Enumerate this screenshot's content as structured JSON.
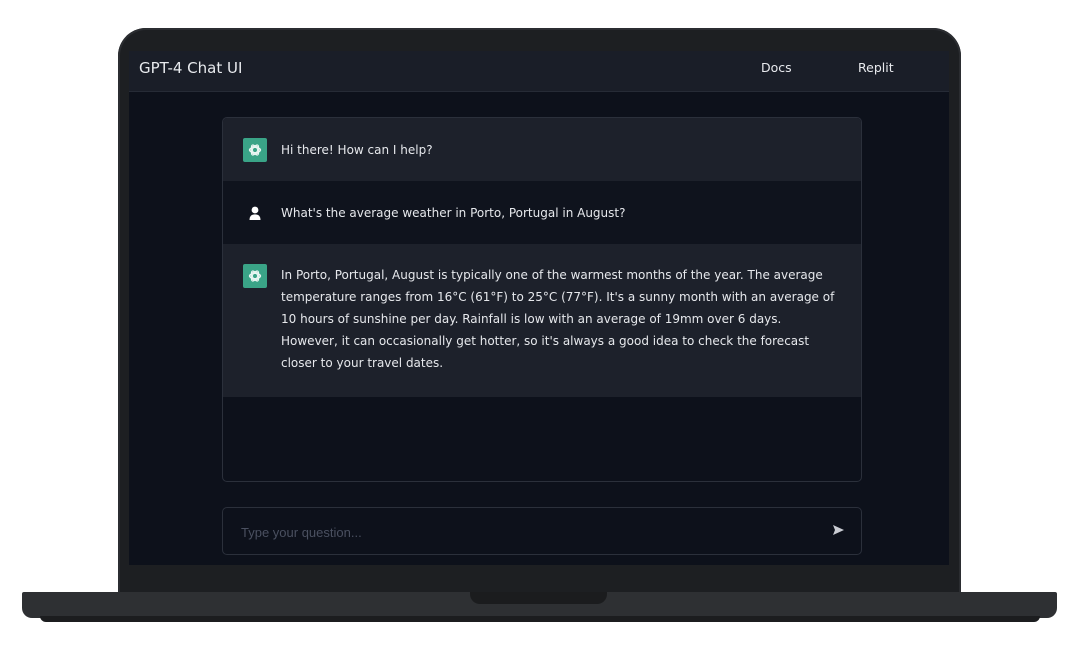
{
  "app": {
    "title": "GPT-4 Chat UI",
    "nav_links": [
      "Docs",
      "Replit"
    ]
  },
  "messages": [
    {
      "role": "assistant",
      "avatar_icon": "openai-logo-icon",
      "text": "Hi there! How can I help?"
    },
    {
      "role": "user",
      "avatar_icon": "user-icon",
      "text": "What's the average weather in Porto, Portugal in August?"
    },
    {
      "role": "assistant",
      "avatar_icon": "openai-logo-icon",
      "text": "In Porto, Portugal, August is typically one of the warmest months of the year. The average temperature ranges from 16°C (61°F) to 25°C (77°F). It's a sunny month with an average of 10 hours of sunshine per day. Rainfall is low with an average of 19mm over 6 days. However, it can occasionally get hotter, so it's always a good idea to check the forecast closer to your travel dates."
    }
  ],
  "input": {
    "placeholder": "Type your question...",
    "value": "",
    "send_icon": "send-icon"
  },
  "colors": {
    "background": "#0d111b",
    "navbar": "#1a1e28",
    "assistant_message_bg": "#1d212b",
    "user_message_bg": "#0f131d",
    "bot_avatar": "#3aa487",
    "text": "#e6e8ec"
  }
}
